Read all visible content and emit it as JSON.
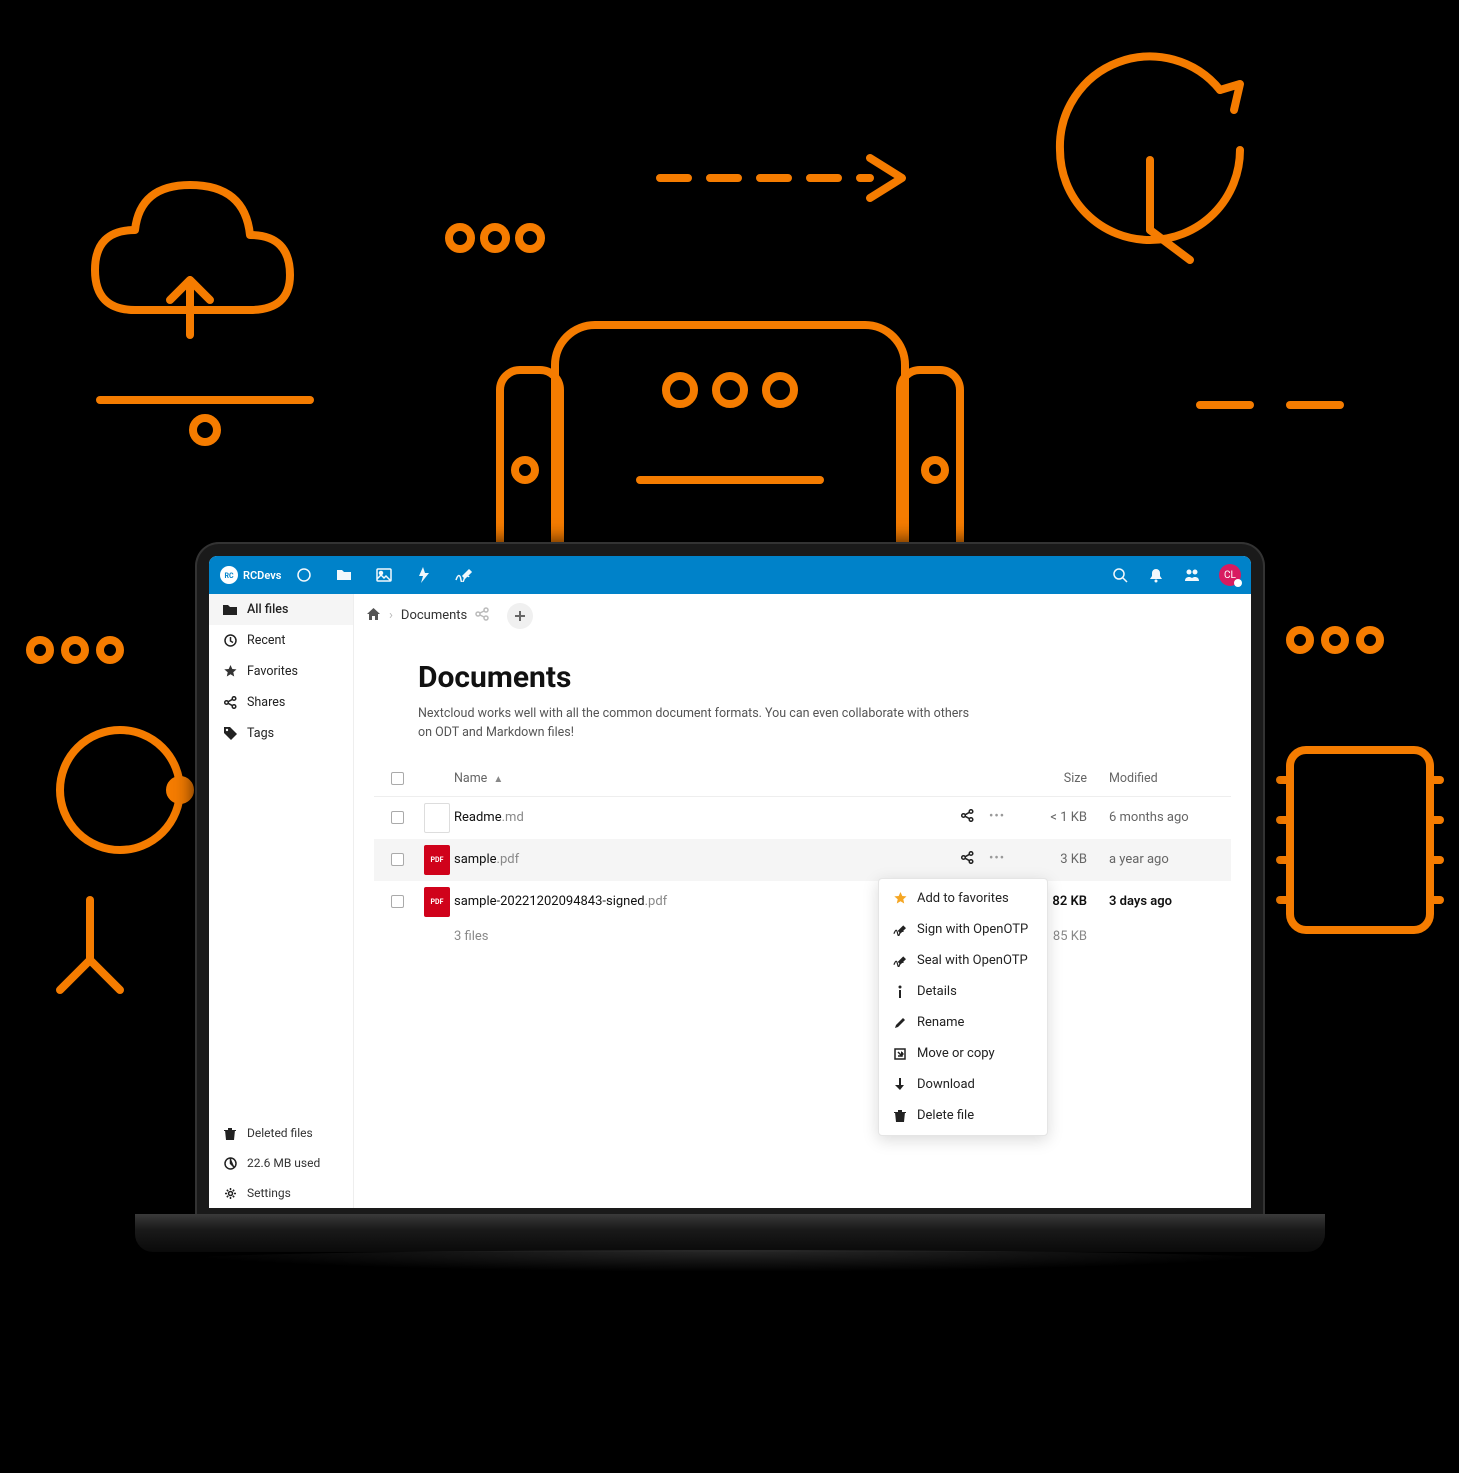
{
  "brand": "RCDevs",
  "topbar_icons": [
    "dashboard-icon",
    "files-icon",
    "photos-icon",
    "activity-icon",
    "sign-icon"
  ],
  "topbar_right_icons": [
    "search-icon",
    "notifications-icon",
    "contacts-icon"
  ],
  "avatar_initials": "CL",
  "sidebar": {
    "items": [
      {
        "icon": "folder-icon",
        "label": "All files",
        "active": true
      },
      {
        "icon": "clock-icon",
        "label": "Recent"
      },
      {
        "icon": "star-icon",
        "label": "Favorites"
      },
      {
        "icon": "share-icon",
        "label": "Shares"
      },
      {
        "icon": "tag-icon",
        "label": "Tags"
      }
    ],
    "bottom": [
      {
        "icon": "trash-icon",
        "label": "Deleted files"
      },
      {
        "icon": "pie-icon",
        "label": "22.6 MB used"
      },
      {
        "icon": "gear-icon",
        "label": "Settings"
      }
    ]
  },
  "breadcrumb": {
    "home_icon": "home-icon",
    "current": "Documents"
  },
  "page": {
    "title": "Documents",
    "subtitle": "Nextcloud works well with all the common document formats. You can even collaborate with others on ODT and Markdown files!"
  },
  "columns": {
    "name": "Name",
    "size": "Size",
    "modified": "Modified"
  },
  "files": [
    {
      "type": "md",
      "name": "Readme",
      "ext": ".md",
      "size": "< 1 KB",
      "modified": "6 months ago",
      "actions": true,
      "bold": false
    },
    {
      "type": "pdf",
      "name": "sample",
      "ext": ".pdf",
      "size": "3 KB",
      "modified": "a year ago",
      "actions": true,
      "hovered": true,
      "bold": false
    },
    {
      "type": "pdf",
      "name": "sample-20221202094843-signed",
      "ext": ".pdf",
      "size": "82 KB",
      "modified": "3 days ago",
      "actions": false,
      "bold": true
    }
  ],
  "summary": {
    "count": "3 files",
    "total_size": "85 KB"
  },
  "context_menu": [
    {
      "icon": "star-icon",
      "label": "Add to favorites",
      "gold": true
    },
    {
      "icon": "pen-icon",
      "label": "Sign with OpenOTP"
    },
    {
      "icon": "pen-icon",
      "label": "Seal with OpenOTP"
    },
    {
      "icon": "info-icon",
      "label": "Details"
    },
    {
      "icon": "pencil-icon",
      "label": "Rename"
    },
    {
      "icon": "move-icon",
      "label": "Move or copy"
    },
    {
      "icon": "download-icon",
      "label": "Download"
    },
    {
      "icon": "trash-icon",
      "label": "Delete file"
    }
  ]
}
